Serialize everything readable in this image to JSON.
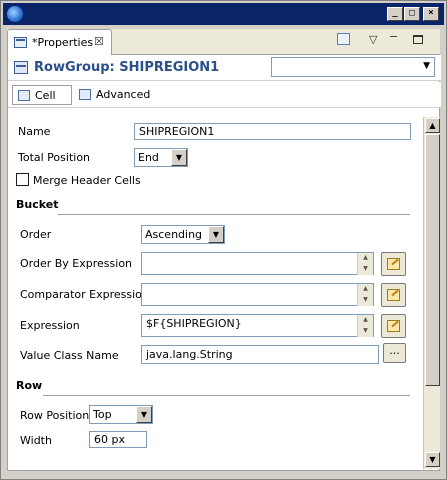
{
  "view": {
    "tab_label": "*Properties",
    "close_glyph": "☒",
    "toolbar_icons": [
      "pin-view-icon",
      "view-menu-icon",
      "minimize-icon",
      "maximize-icon"
    ]
  },
  "header": {
    "title": "RowGroup: SHIPREGION1",
    "selector_value": ""
  },
  "tabs": [
    {
      "label": "Cell"
    },
    {
      "label": "Advanced"
    }
  ],
  "form": {
    "name_label": "Name",
    "name_value": "SHIPREGION1",
    "total_position_label": "Total Position",
    "total_position_value": "End",
    "merge_header_label": "Merge Header Cells",
    "bucket_title": "Bucket",
    "order_label": "Order",
    "order_value": "Ascending",
    "order_by_label": "Order By Expression",
    "order_by_value": "",
    "comparator_label": "Comparator Expression",
    "comparator_value": "",
    "expression_label": "Expression",
    "expression_value": "$F{SHIPREGION}",
    "value_class_label": "Value Class Name",
    "value_class_value": "java.lang.String",
    "browse_label": "...",
    "row_title": "Row",
    "row_position_label": "Row Position",
    "row_position_value": "Top",
    "width_label": "Width",
    "width_value": "60 px"
  },
  "colors": {
    "title_bar": "#0a246a",
    "header_title": "#2a4f8a"
  }
}
